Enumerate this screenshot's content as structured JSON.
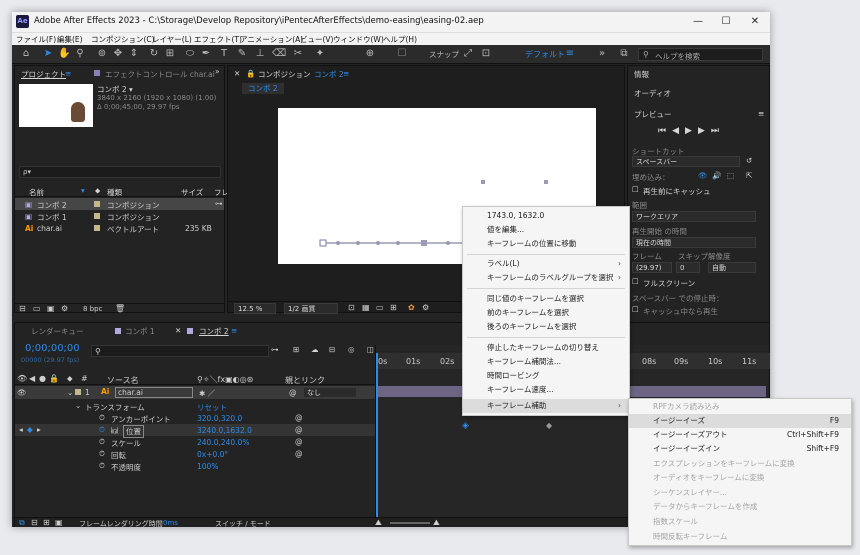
{
  "window": {
    "app_icon": "Ae",
    "title": "Adobe After Effects 2023 - C:\\Storage\\Develop Repository\\iPentecAfterEffects\\demo-easing\\easing-02.aep",
    "min": "—",
    "max": "☐",
    "close": "✕"
  },
  "menu": [
    "ファイル(F)",
    "編集(E)",
    "コンポジション(C)",
    "レイヤー(L)",
    "エフェクト(T)",
    "アニメーション(A)",
    "ビュー(V)",
    "ウィンドウ(W)",
    "ヘルプ(H)"
  ],
  "toolbar": {
    "snap": "スナップ",
    "workspace": "デフォルト",
    "search_placeholder": "ヘルプを検索"
  },
  "project": {
    "tab": "プロジェクト",
    "tab2": "エフェクトコントロール char.ai",
    "comp_name": "コンポ 2 ▾",
    "comp_info1": "3840 x 2160 (1920 x 1080) (1.00)",
    "comp_info2": "Δ 0;00;45;00, 29.97 fps",
    "search": "ρ▾",
    "col_name": "名前",
    "col_type": "種類",
    "col_size": "サイズ",
    "col_fr": "フレ",
    "items": [
      {
        "name": "コンポ 2",
        "type": "コンポジション",
        "size": ""
      },
      {
        "name": "コンポ 1",
        "type": "コンポジション",
        "size": ""
      },
      {
        "name": "char.ai",
        "type": "ベクトルアート",
        "size": "235 KB"
      }
    ],
    "bpc": "8 bpc"
  },
  "comp": {
    "tab": "コンポジション",
    "tab_name": "コンポ 2",
    "crumb": "コンポ 2",
    "zoom": "12.5 %",
    "quality": "1/2 画質"
  },
  "right": {
    "info": "情報",
    "audio": "オーディオ",
    "preview": "プレビュー",
    "shortcut_label": "ショートカット",
    "shortcut": "スペースバー",
    "include": "埋め込み：",
    "cache": "再生前にキャッシュ",
    "range_label": "範囲",
    "range": "ワークエリア",
    "start_label": "再生開始 の時間",
    "start": "現在の時間",
    "frame_label": "フレーム",
    "skip_label": "スキップ",
    "res_label": "解像度",
    "frame": "(29.97)",
    "skip": "0",
    "res": "自動",
    "fullscreen": "フルスクリーン",
    "stop_label": "スペースバー での停止時：",
    "cache2": "キャッシュ中なら再生"
  },
  "timeline": {
    "tabs": [
      "レンダーキュー",
      "コンポ 1",
      "コンポ 2"
    ],
    "timecode": "0;00;00;00",
    "fps": "00000 (29.97 fps)",
    "col_src": "ソース名",
    "col_parent": "親とリンク",
    "layer_num": "1",
    "layer_name": "char.ai",
    "parent": "なし",
    "transform": "トランスフォーム",
    "reset": "リセット",
    "props": [
      {
        "name": "アンカーポイント",
        "value": "320.0,320.0"
      },
      {
        "name": "位置",
        "value": "3240.0,1632.0"
      },
      {
        "name": "スケール",
        "value": "240.0,240.0%"
      },
      {
        "name": "回転",
        "value": "0x+0.0°"
      },
      {
        "name": "不透明度",
        "value": "100%"
      }
    ],
    "ruler": [
      "0s",
      "01s",
      "02s",
      "08s",
      "09s",
      "10s",
      "11s"
    ],
    "footer": "フレームレンダリング時間",
    "footer_ms": "0ms",
    "footer_switch": "スイッチ / モード"
  },
  "context_menu": {
    "header": "1743.0, 1632.0",
    "items": [
      "値を編集...",
      "キーフレームの位置に移動",
      "ラベル(L)",
      "キーフレームのラベルグループを選択",
      "同じ値のキーフレームを選択",
      "前のキーフレームを選択",
      "後ろのキーフレームを選択",
      "停止したキーフレームの切り替え",
      "キーフレーム補間法...",
      "時間ロービング",
      "キーフレーム速度...",
      "キーフレーム補助"
    ]
  },
  "submenu": {
    "items": [
      {
        "label": "RPFカメラ読み込み",
        "shortcut": "",
        "enabled": false
      },
      {
        "label": "イージーイーズ",
        "shortcut": "F9",
        "enabled": true
      },
      {
        "label": "イージーイーズアウト",
        "shortcut": "Ctrl+Shift+F9",
        "enabled": true
      },
      {
        "label": "イージーイーズイン",
        "shortcut": "Shift+F9",
        "enabled": true
      },
      {
        "label": "エクスプレッションをキーフレームに変換",
        "shortcut": "",
        "enabled": false
      },
      {
        "label": "オーディオをキーフレームに変換",
        "shortcut": "",
        "enabled": false
      },
      {
        "label": "シーケンスレイヤー...",
        "shortcut": "",
        "enabled": false
      },
      {
        "label": "データからキーフレームを作成",
        "shortcut": "",
        "enabled": false
      },
      {
        "label": "指数スケール",
        "shortcut": "",
        "enabled": false
      },
      {
        "label": "時間反転キーフレーム",
        "shortcut": "",
        "enabled": false
      }
    ]
  }
}
